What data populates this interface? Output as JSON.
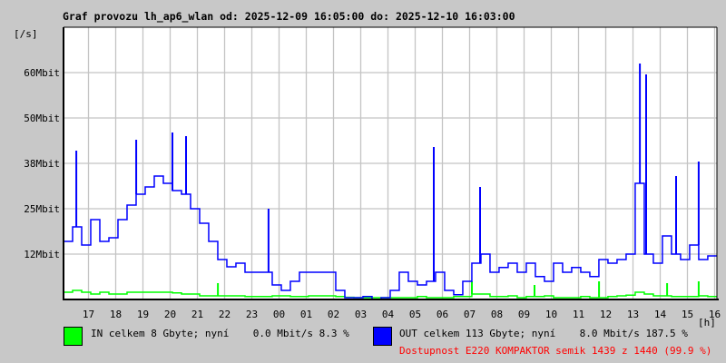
{
  "chart_data": {
    "type": "line",
    "title": "Graf provozu lh_ap6_wlan od: 2025-12-09 16:05:00 do: 2025-12-10 16:03:00",
    "ylabel": "[/s]",
    "xlabel": "[h]",
    "ylim": [
      0,
      75
    ],
    "xlim_hours": [
      0,
      24
    ],
    "y_ticks": [
      {
        "v": 12.5,
        "label": "12Mbit"
      },
      {
        "v": 25,
        "label": "25Mbit"
      },
      {
        "v": 37.5,
        "label": "38Mbit"
      },
      {
        "v": 50,
        "label": "50Mbit"
      },
      {
        "v": 62.5,
        "label": "60Mbit"
      }
    ],
    "x_ticks": [
      "17",
      "18",
      "19",
      "20",
      "21",
      "22",
      "23",
      "00",
      "01",
      "02",
      "03",
      "04",
      "05",
      "06",
      "07",
      "08",
      "09",
      "10",
      "11",
      "12",
      "13",
      "14",
      "15",
      "16"
    ],
    "first_tick_offset_hours": 0.9167,
    "sample_step_hours": 0.3333,
    "grid": true,
    "series": [
      {
        "name": "IN",
        "color": "#00ff00",
        "values": [
          2,
          2.5,
          2,
          1.5,
          2,
          1.5,
          1.5,
          2,
          2,
          2,
          2,
          2,
          1.8,
          1.5,
          1.5,
          1,
          1,
          1,
          1,
          1,
          0.8,
          0.8,
          0.8,
          1,
          1,
          0.8,
          0.8,
          1,
          1,
          1,
          0.8,
          0.6,
          0.5,
          0.5,
          0.5,
          0.5,
          0.5,
          0.5,
          0.5,
          0.8,
          0.5,
          0.5,
          0.5,
          0.8,
          0.8,
          1.5,
          1.5,
          0.8,
          0.8,
          1,
          0.5,
          0.8,
          0.8,
          1,
          0.5,
          0.5,
          0.5,
          0.8,
          0.5,
          0.5,
          0.8,
          1,
          1.2,
          2,
          1.5,
          1,
          1,
          0.8,
          0.8,
          0.8,
          1,
          0.8
        ],
        "peaks": [
          {
            "h": 5.67,
            "v": 4.5
          },
          {
            "h": 15,
            "v": 5
          },
          {
            "h": 17.3,
            "v": 4
          },
          {
            "h": 19.67,
            "v": 5
          },
          {
            "h": 22.17,
            "v": 4.5
          },
          {
            "h": 23.33,
            "v": 5
          }
        ]
      },
      {
        "name": "OUT",
        "color": "#0000ff",
        "values": [
          16,
          20,
          15,
          22,
          16,
          17,
          22,
          26,
          29,
          31,
          34,
          32,
          30,
          29,
          25,
          21,
          16,
          11,
          9,
          10,
          7.5,
          7.5,
          7.5,
          4,
          2.5,
          5,
          7.5,
          7.5,
          7.5,
          7.5,
          2.5,
          0.5,
          0.5,
          0.8,
          0,
          0.5,
          2.5,
          7.5,
          5,
          4,
          5,
          7.5,
          2.5,
          1.3,
          5,
          10,
          12.5,
          7.5,
          8.8,
          10,
          7.5,
          10,
          6.3,
          5,
          10,
          7.5,
          8.8,
          7.5,
          6.3,
          11,
          10,
          11,
          12.5,
          32,
          12.5,
          10,
          17.5,
          12.5,
          11,
          15,
          11,
          12
        ],
        "peaks": [
          {
            "h": 0.47,
            "v": 41
          },
          {
            "h": 2.67,
            "v": 44
          },
          {
            "h": 4,
            "v": 46
          },
          {
            "h": 4.5,
            "v": 45
          },
          {
            "h": 7.53,
            "v": 25
          },
          {
            "h": 13.6,
            "v": 42
          },
          {
            "h": 15.3,
            "v": 31
          },
          {
            "h": 21.17,
            "v": 65
          },
          {
            "h": 21.4,
            "v": 62
          },
          {
            "h": 22.5,
            "v": 34
          },
          {
            "h": 23.33,
            "v": 38
          }
        ]
      }
    ]
  },
  "legend": {
    "in_text": "IN celkem 8 Gbyte; nyní    0.0 Mbit/s 8.3 %",
    "out_text": "OUT celkem 113 Gbyte; nyní    8.0 Mbit/s 187.5 %",
    "availability": "Dostupnost E220 KOMPAKTOR semik 1439 z 1440 (99.9 %)"
  }
}
